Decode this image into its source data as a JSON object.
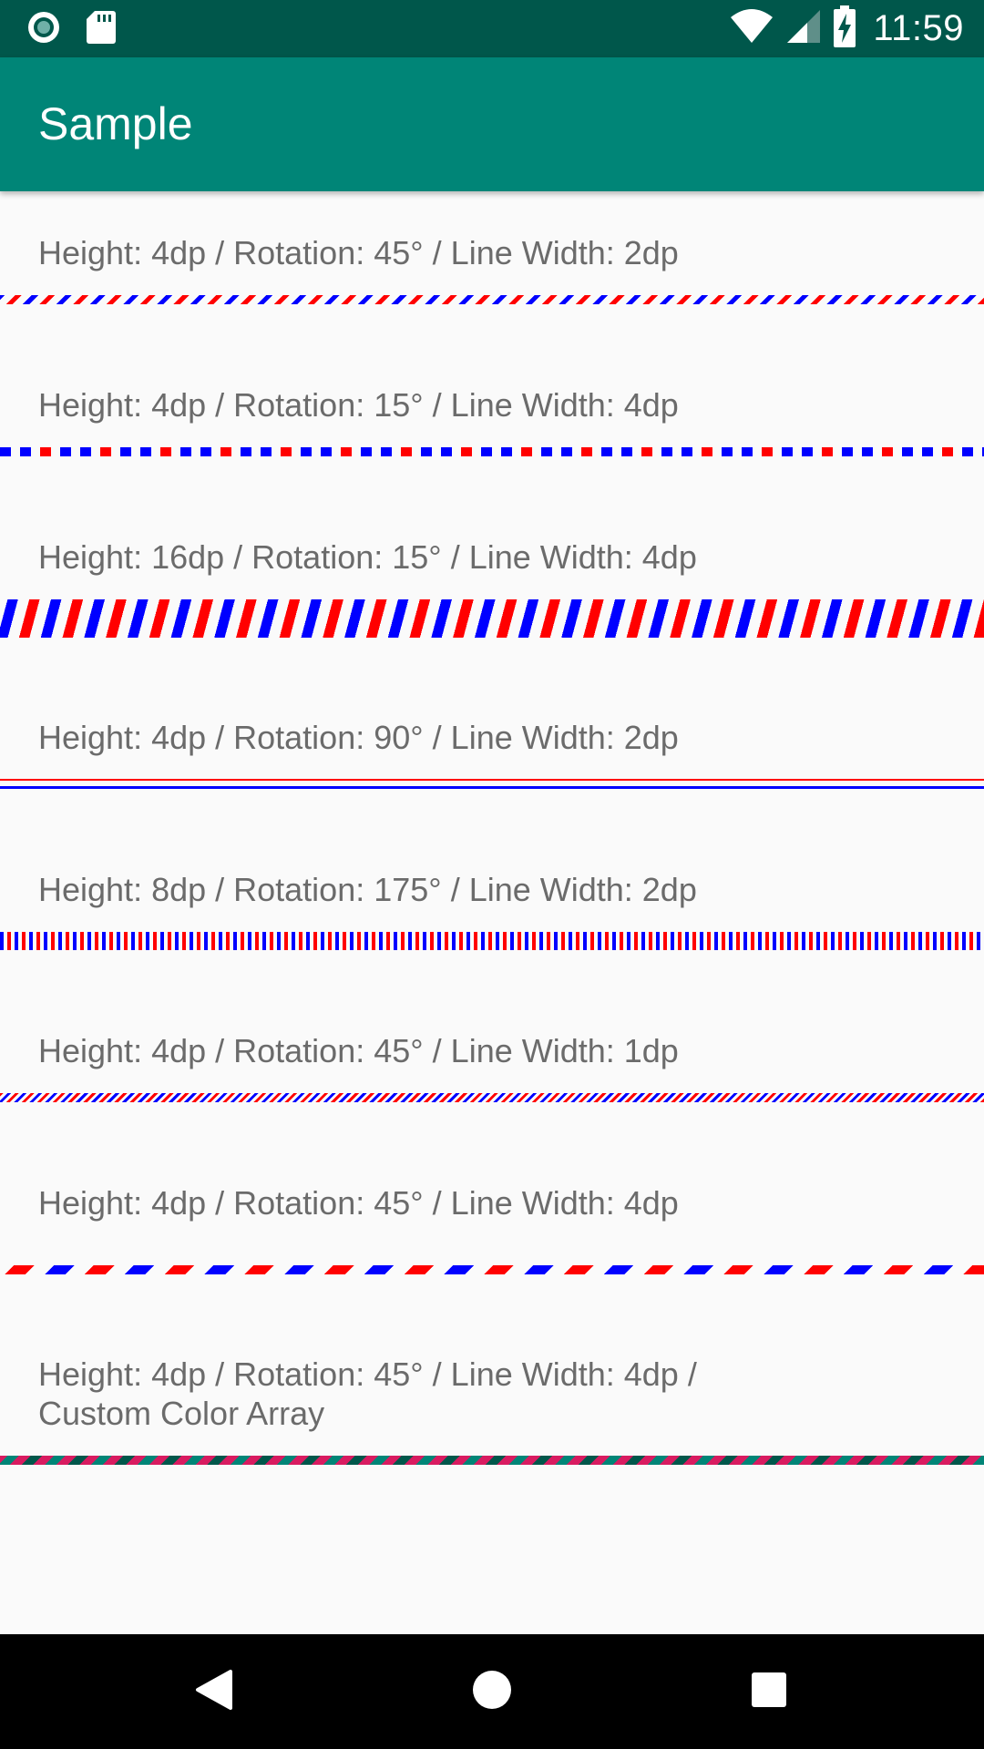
{
  "status_bar": {
    "time": "11:59",
    "left_icons": [
      "record-icon",
      "sd-card-icon"
    ],
    "right_icons": [
      "wifi-icon",
      "cell-signal-icon",
      "battery-charging-icon"
    ],
    "color": "#00574b"
  },
  "app_bar": {
    "title": "Sample",
    "color": "#008577"
  },
  "samples": [
    {
      "label": "Height: 4dp / Rotation: 45° / Line Width: 2dp",
      "colors": [
        "#ff0000",
        "#0000ff"
      ]
    },
    {
      "label": "Height: 4dp / Rotation: 15° / Line Width: 4dp",
      "colors": [
        "#ff0000",
        "#0000ff"
      ]
    },
    {
      "label": "Height: 16dp / Rotation: 15° / Line Width: 4dp",
      "colors": [
        "#ff0000",
        "#0000ff"
      ]
    },
    {
      "label": "Height: 4dp / Rotation: 90° / Line Width: 2dp",
      "colors": [
        "#ff0000",
        "#0000ff"
      ]
    },
    {
      "label": "Height: 8dp / Rotation: 175° / Line Width: 2dp",
      "colors": [
        "#ff0000",
        "#0000ff"
      ]
    },
    {
      "label": "Height: 4dp / Rotation: 45° / Line Width: 1dp",
      "colors": [
        "#ff0000",
        "#0000ff"
      ]
    },
    {
      "label": "Height: 4dp / Rotation: 45° / Line Width: 4dp",
      "colors": [
        "#ff0000",
        "#0000ff"
      ]
    },
    {
      "label_line1": "Height: 4dp / Rotation: 45° / Line Width: 4dp /",
      "label_line2": "Custom Color Array",
      "colors": [
        "#008577",
        "#d81b60",
        "#00574b"
      ]
    }
  ],
  "nav_bar": {
    "buttons": [
      "back-icon",
      "home-icon",
      "recents-icon"
    ]
  }
}
